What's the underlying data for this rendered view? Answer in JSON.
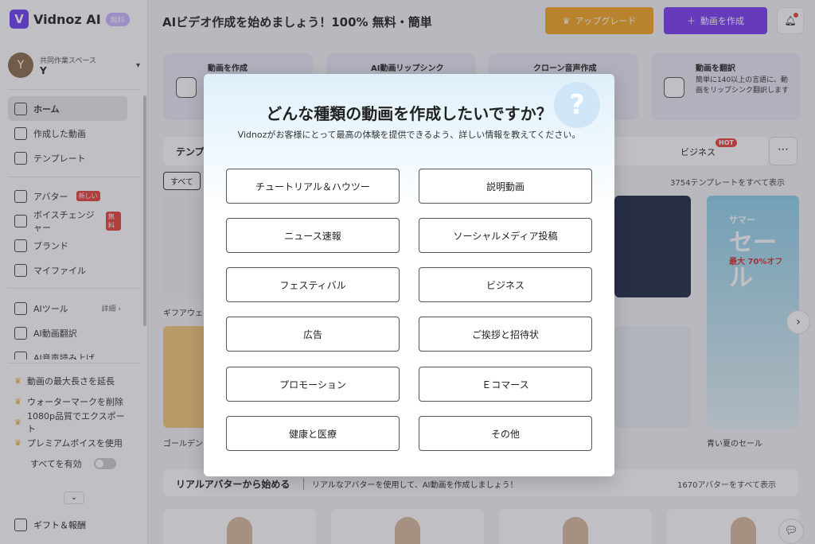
{
  "brand": {
    "name": "Vidnoz AI",
    "badge": "無料"
  },
  "workspace": {
    "label": "共同作業スペース",
    "name": "Y",
    "initial": "Y"
  },
  "sidebar": {
    "nav": [
      {
        "label": "ホーム"
      },
      {
        "label": "作成した動画"
      },
      {
        "label": "テンプレート"
      }
    ],
    "nav2": [
      {
        "label": "アバター",
        "badge": "新しい"
      },
      {
        "label": "ボイスチェンジャー",
        "badge": "無料"
      },
      {
        "label": "ブランド"
      },
      {
        "label": "マイファイル"
      }
    ],
    "tools": [
      {
        "label": "AIツール",
        "detail": "詳細 ›"
      },
      {
        "label": "AI動画翻訳"
      },
      {
        "label": "AI音声読み上げ"
      }
    ],
    "perks": [
      "動画の最大長さを延長",
      "ウォーターマークを削除",
      "1080p品質でエクスポート",
      "プレミアムボイスを使用"
    ],
    "enable_all": "すべてを有効",
    "gift": "ギフト＆報酬"
  },
  "header": {
    "headline": "AIビデオ作成を始めましょう！100% 無料・簡単",
    "upgrade": "アップグレード",
    "create": "動画を作成"
  },
  "cards": [
    {
      "title": "動画を作成",
      "desc": ""
    },
    {
      "title": "AI動画リップシンク",
      "desc": ""
    },
    {
      "title": "クローン音声作成",
      "desc": ""
    },
    {
      "title": "動画を翻訳",
      "desc": "簡単に140以上の言語に、動画をリップシンク翻訳します"
    }
  ],
  "templates": {
    "tab_left": "テンプレート",
    "tab_business": "ビジネス",
    "hot": "HOT",
    "filter_all": "すべて",
    "all_link": "3754テンプレートをすべて表示",
    "caption1": "ギフアウェ",
    "caption2": "ゴールデン",
    "caption3": "青い夏のセール",
    "sale": {
      "head": "サマー",
      "big": "セール",
      "sub": "最大 70%オフ"
    }
  },
  "avatars": {
    "title": "リアルアバターから始める",
    "subtitle": "リアルなアバターを使用して、AI動画を作成しましょう！",
    "link": "1670アバターをすべて表示"
  },
  "modal": {
    "title": "どんな種類の動画を作成したいですか？",
    "subtitle": "Vidnozがお客様にとって最高の体験を提供できるよう、詳しい情報を教えてください。",
    "options": [
      "チュートリアル＆ハウツー",
      "説明動画",
      "ニュース速報",
      "ソーシャルメディア投稿",
      "フェスティバル",
      "ビジネス",
      "広告",
      "ご挨拶と招待状",
      "プロモーション",
      "Ｅコマース",
      "健康と医療",
      "その他"
    ]
  }
}
